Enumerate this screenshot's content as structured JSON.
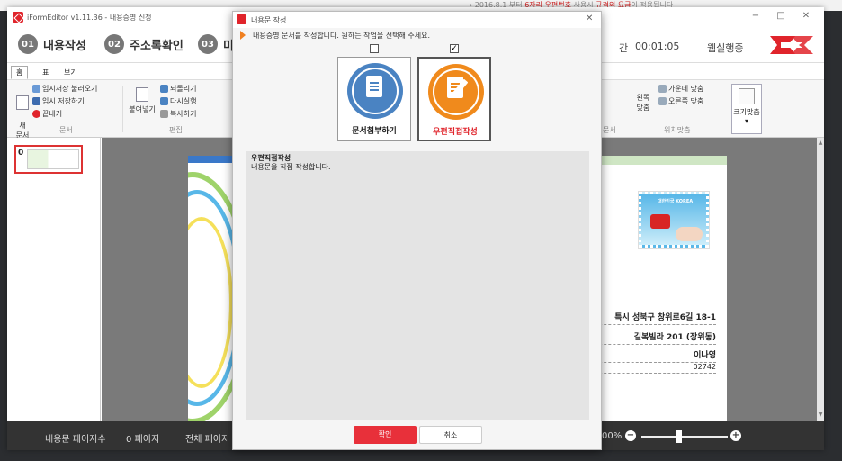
{
  "background": {
    "notice_prefix": "› 2016.8.1 부터 ",
    "notice_red1": "6자리 우편번호",
    "notice_mid": " 사용시 ",
    "notice_red2": "규격외 요금",
    "notice_suffix": "이 적용됩니다"
  },
  "app": {
    "title": "iFormEditor v1.11.36 - 내용증명 신청",
    "window_controls": [
      "−",
      "□",
      "✕"
    ]
  },
  "steps": [
    {
      "num": "01",
      "label": "내용작성"
    },
    {
      "num": "02",
      "label": "주소록확인"
    },
    {
      "num": "03",
      "label": "미리"
    }
  ],
  "header": {
    "timer_prefix": "간",
    "timer": "00:01:05",
    "status": "웹실행중"
  },
  "menu": {
    "tabs": [
      "홈",
      "표",
      "보기"
    ]
  },
  "ribbon": {
    "new_doc": "새\n문서",
    "items": {
      "load_temp": "임시저장 불러오기",
      "save_temp": "임시 저장하기",
      "close": "끝내기",
      "paste": "붙여넣기",
      "undo": "되돌리기",
      "redo": "다시실행",
      "copy": "복사하기",
      "align_center": "가운데 맞춤",
      "align_right": "오른쪽 맞춤",
      "align_left": "왼쪽\n맞춤",
      "fit_size": "크기맞춤"
    },
    "groups": {
      "document": "문서",
      "edit": "편집",
      "doc2": "문서",
      "position": "위치맞춤"
    },
    "fit_arrow": "▾"
  },
  "thumbnails": [
    {
      "num": "0"
    }
  ],
  "envelope": {
    "stamp_text": "대한민국 KOREA",
    "address_lines": [
      "특시 성북구 창위로6길 18-1",
      "길복빌라 201 (장위동)",
      "이나영",
      "02742"
    ]
  },
  "statusbar": {
    "page_count_label": "내용문 페이지수",
    "page_count_value": "0 페이지",
    "total_pages_label": "전체 페이지",
    "zoom": "00%",
    "zoom_minus": "−",
    "zoom_plus": "+"
  },
  "dialog": {
    "title": "내용문 작성",
    "close": "✕",
    "instruction": "내용증명 문서를 작성합니다. 원하는 작업을 선택해 주세요.",
    "options": [
      {
        "label": "문서첨부하기",
        "checked": false,
        "check_mark": "",
        "icon": "paperclip-document-icon",
        "color": "#4a83c2"
      },
      {
        "label": "우편직접작성",
        "checked": true,
        "check_mark": "✓",
        "icon": "pencil-document-icon",
        "color": "#f08a1c"
      }
    ],
    "description_title": "우편직접작성",
    "description_body": "내용문을 직접 작성합니다.",
    "ok_label": "확인",
    "cancel_label": "취소"
  },
  "colors": {
    "accent_red": "#e8303a",
    "option_blue": "#4a83c2",
    "option_orange": "#f08a1c"
  }
}
